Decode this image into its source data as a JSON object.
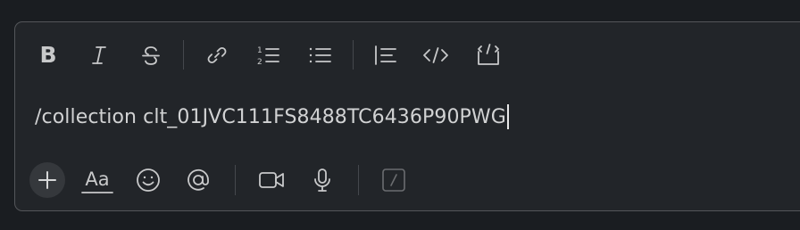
{
  "composer": {
    "message_text": "/collection clt_01JVC111FS8488TC6436P90PWG"
  },
  "toolbar": {
    "items": [
      {
        "name": "bold-button",
        "icon": "bold-icon"
      },
      {
        "name": "italic-button",
        "icon": "italic-icon"
      },
      {
        "name": "strikethrough-button",
        "icon": "strikethrough-icon"
      },
      {
        "name": "link-button",
        "icon": "link-icon"
      },
      {
        "name": "ordered-list-button",
        "icon": "ordered-list-icon"
      },
      {
        "name": "bulleted-list-button",
        "icon": "bulleted-list-icon"
      },
      {
        "name": "blockquote-button",
        "icon": "blockquote-icon"
      },
      {
        "name": "code-button",
        "icon": "code-icon"
      },
      {
        "name": "code-block-button",
        "icon": "code-block-icon"
      }
    ]
  },
  "bottom_bar": {
    "items": [
      {
        "name": "attach-button",
        "icon": "plus-icon"
      },
      {
        "name": "formatting-toggle-button",
        "icon": "text-format-icon",
        "label": "Aa"
      },
      {
        "name": "emoji-button",
        "icon": "smiley-icon"
      },
      {
        "name": "mention-button",
        "icon": "at-icon"
      },
      {
        "name": "video-clip-button",
        "icon": "video-camera-icon"
      },
      {
        "name": "audio-clip-button",
        "icon": "microphone-icon"
      },
      {
        "name": "slash-command-button",
        "icon": "slash-icon"
      }
    ]
  },
  "colors": {
    "page_background": "#1a1d21",
    "composer_background": "#222529",
    "composer_border": "#54565a",
    "icon": "#c8c9ca",
    "text": "#d1d2d3"
  }
}
